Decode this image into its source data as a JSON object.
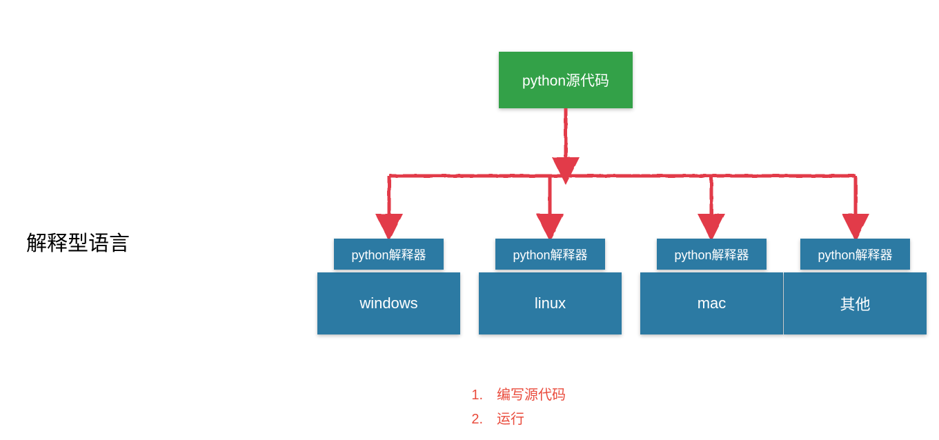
{
  "title": "解释型语言",
  "source_code_box": "python源代码",
  "interpreter_label": "python解释器",
  "platforms": [
    "windows",
    "linux",
    "mac",
    "其他"
  ],
  "steps": [
    "编写源代码",
    "运行"
  ],
  "colors": {
    "source_box": "#33a148",
    "platform_box": "#2c7aa3",
    "arrow": "#e23b4a",
    "step_text": "#e94b3c"
  },
  "layout": {
    "platform_positions": [
      460,
      694,
      928,
      1136
    ]
  }
}
